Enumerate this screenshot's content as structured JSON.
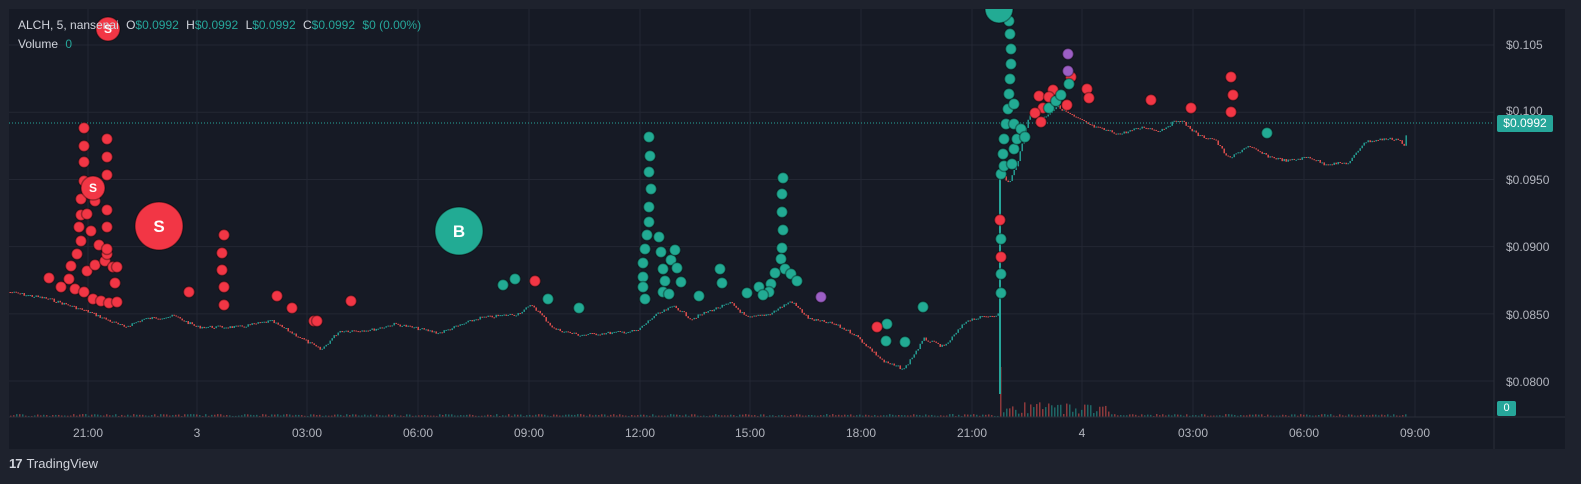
{
  "legend": {
    "symbol": "ALCH, 5, nansenai",
    "o_label": "O",
    "o_value": "$0.0992",
    "h_label": "H",
    "h_value": "$0.0992",
    "l_label": "L",
    "l_value": "$0.0992",
    "c_label": "C",
    "c_value": "$0.0992",
    "change": "$0 (0.00%)",
    "volume_label": "Volume",
    "volume_value": "0"
  },
  "price_axis": [
    "$0.105",
    "$0.100",
    "$0.0950",
    "$0.0900",
    "$0.0850",
    "$0.0800"
  ],
  "last_price_tag": "$0.0992",
  "volume_tag": "0",
  "time_axis": [
    "21:00",
    "3",
    "03:00",
    "06:00",
    "09:00",
    "12:00",
    "15:00",
    "18:00",
    "21:00",
    "4",
    "03:00",
    "06:00",
    "09:00"
  ],
  "brand": {
    "logo": "17",
    "name": "TradingView"
  },
  "markers": {
    "sell": "S",
    "buy": "B"
  },
  "colors": {
    "up": "#26a69a",
    "down": "#ef5350",
    "sell_marker": "#f23645",
    "buy_marker": "#22ab94",
    "other_marker": "#9c5fc5",
    "background": "#161a25"
  },
  "chart_data": {
    "type": "line",
    "title": "ALCH, 5, nansenai",
    "x": [
      "21:00",
      "3",
      "03:00",
      "06:00",
      "09:00",
      "12:00",
      "15:00",
      "18:00",
      "21:00",
      "4",
      "03:00",
      "06:00",
      "09:00"
    ],
    "series": [
      {
        "values": [
          0.0852,
          0.0841,
          0.0846,
          0.0832,
          0.0851,
          0.0837,
          0.0856,
          0.0848,
          0.0846,
          0.0998,
          0.0988,
          0.0962,
          0.0992
        ]
      }
    ],
    "ylim": [
      0.0775,
      0.1075
    ]
  }
}
